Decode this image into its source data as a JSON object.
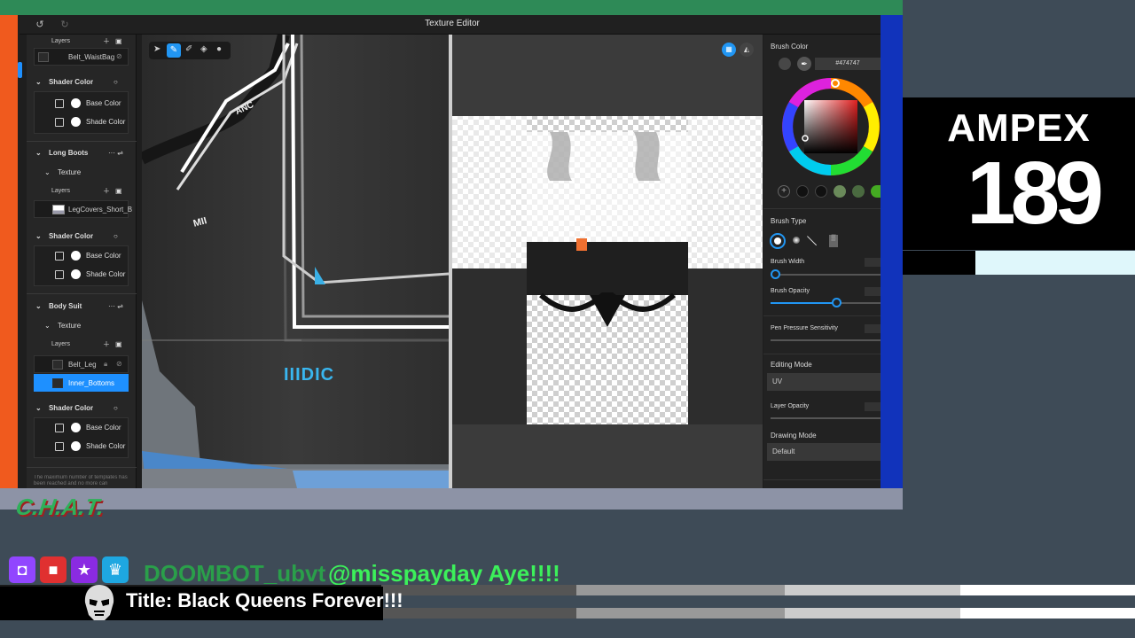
{
  "app": {
    "window_title": "Texture Editor"
  },
  "left_panel": {
    "layers_label": "Layers",
    "waist_layer": "Belt_WaistBag",
    "shader_color": "Shader Color",
    "base_color": "Base Color",
    "shade_color": "Shade Color",
    "long_boots": "Long Boots",
    "texture": "Texture",
    "boots_layer": "LegCovers_Short_B",
    "body_suit": "Body Suit",
    "belt_leg": "Belt_Leg",
    "inner_bottoms": "Inner_Bottoms",
    "notice": "The maximum number of templates has been reached and no more can"
  },
  "viewport": {
    "jacket_text_1": "ANC",
    "jacket_text_2": "MII",
    "jacket_logo": "IIIDIC"
  },
  "right_panel": {
    "brush_color": "Brush Color",
    "hex_value": "#474747",
    "brush_type": "Brush Type",
    "brush_width": "Brush Width",
    "brush_opacity": "Brush Opacity",
    "brush_opacity_value": 0.6,
    "pen_pressure": "Pen Pressure Sensitivity",
    "editing_mode": "Editing Mode",
    "editing_mode_value": "UV",
    "layer_opacity": "Layer Opacity",
    "drawing_mode": "Drawing Mode",
    "drawing_mode_value": "Default"
  },
  "overlay": {
    "sponsor": "AMPEX",
    "number": "189",
    "chat_logo": "C.H.A.T.",
    "chat_user": "DOOMBOT_ubvt",
    "chat_message": "@misspayday Aye!!!!",
    "stream_title": "Title: Black Queens Forever!!!"
  },
  "colors": {
    "accent": "#2196f3",
    "selected_layer": "#1e90ff",
    "chat_green": "#3cf05a"
  }
}
